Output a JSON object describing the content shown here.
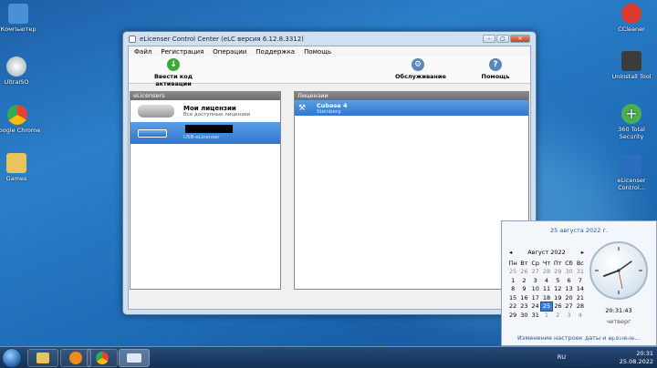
{
  "desktop": {
    "left_icons": [
      {
        "label": "Компьютер",
        "color": "#4a90d9"
      },
      {
        "label": "UltraISO",
        "color": "#c8c8c8"
      },
      {
        "label": "Google Chrome",
        "color": "#e94235"
      },
      {
        "label": "Games",
        "color": "#e8c45a"
      }
    ],
    "right_icons": [
      {
        "label": "CCleaner",
        "color": "#d83b2c"
      },
      {
        "label": "Uninstall Tool",
        "color": "#3c3c3c"
      },
      {
        "label": "360 Total Security",
        "color": "#4caf50"
      },
      {
        "label": "eLicenser Control...",
        "color": "#2a6fbf"
      }
    ]
  },
  "window": {
    "title": "eLicenser Control Center (eLC версия 6.12.8.3312)",
    "menu": [
      "Файл",
      "Регистрация",
      "Операции",
      "Поддержка",
      "Помощь"
    ],
    "toolbar": {
      "activate_label": "Ввести код активации",
      "service_label": "Обслуживание",
      "help_label": "Помощь"
    },
    "left_panel": {
      "header": "eLicensers",
      "items": [
        {
          "title": "Мои лицензии",
          "subtitle": "Все доступные лицензии"
        },
        {
          "title": "",
          "subtitle": "USB-eLicenser"
        }
      ]
    },
    "right_panel": {
      "header": "Лицензии",
      "items": [
        {
          "title": "Cubase 4",
          "subtitle": "Steinberg"
        }
      ]
    }
  },
  "calendar_popup": {
    "header_date": "25 августа 2022 г.",
    "month_label": "Август 2022",
    "weekdays": [
      "Пн",
      "Вт",
      "Ср",
      "Чт",
      "Пт",
      "Сб",
      "Вс"
    ],
    "weeks": [
      [
        "25",
        "26",
        "27",
        "28",
        "29",
        "30",
        "31"
      ],
      [
        "1",
        "2",
        "3",
        "4",
        "5",
        "6",
        "7"
      ],
      [
        "8",
        "9",
        "10",
        "11",
        "12",
        "13",
        "14"
      ],
      [
        "15",
        "16",
        "17",
        "18",
        "19",
        "20",
        "21"
      ],
      [
        "22",
        "23",
        "24",
        "25",
        "26",
        "27",
        "28"
      ],
      [
        "29",
        "30",
        "31",
        "1",
        "2",
        "3",
        "4"
      ]
    ],
    "today": "25",
    "time": "20:31:43",
    "weekday_label": "четверг",
    "settings_link": "Изменение настроек даты и времени..."
  },
  "taskbar": {
    "language": "RU",
    "tray_time": "20:31",
    "tray_date": "25.08.2022"
  },
  "watermark": "Avito"
}
